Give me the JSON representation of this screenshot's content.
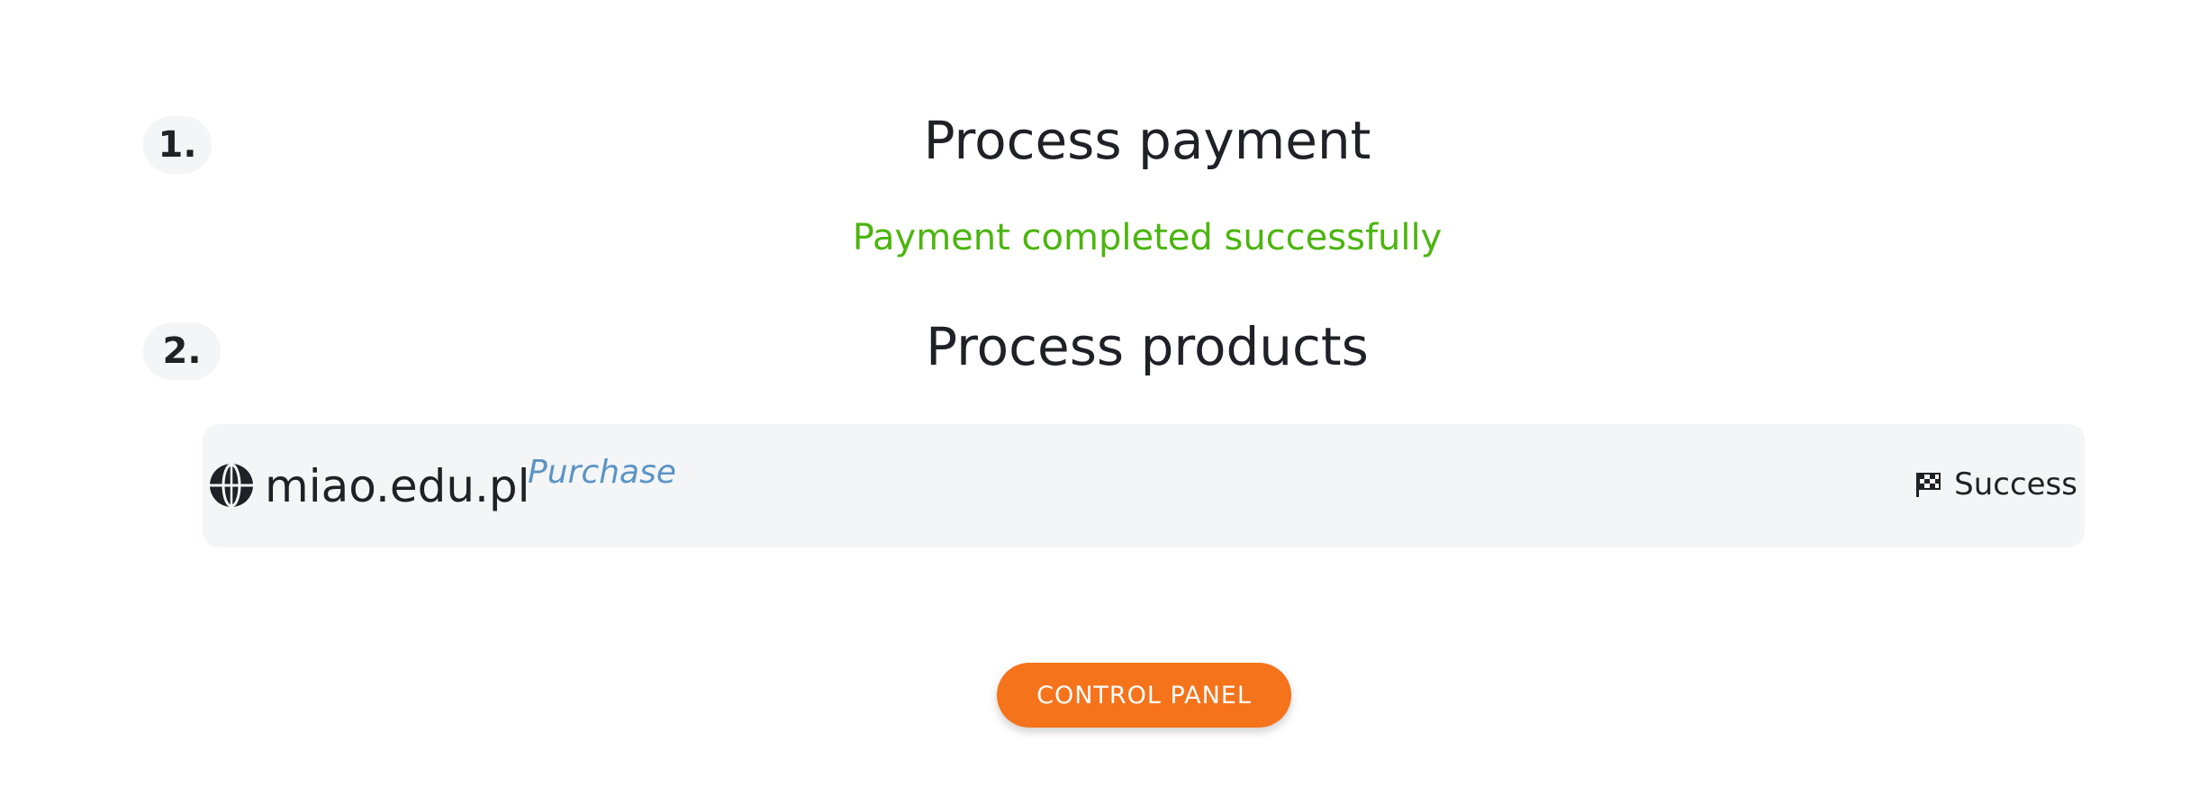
{
  "steps": [
    {
      "number": "1.",
      "title": "Process payment",
      "status": "Payment completed successfully"
    },
    {
      "number": "2.",
      "title": "Process products"
    }
  ],
  "product": {
    "domain": "miao.edu.pl",
    "type": "Purchase",
    "result": "Success",
    "icon": "globe-icon",
    "result_icon": "checkered-flag-icon"
  },
  "actions": {
    "control_panel_label": "CONTROL PANEL"
  },
  "colors": {
    "success_text": "#4cb50f",
    "product_type_text": "#5b94c4",
    "button_bg": "#f5731b",
    "badge_bg": "#f4f5f7",
    "card_bg": "#f4f5f7"
  }
}
